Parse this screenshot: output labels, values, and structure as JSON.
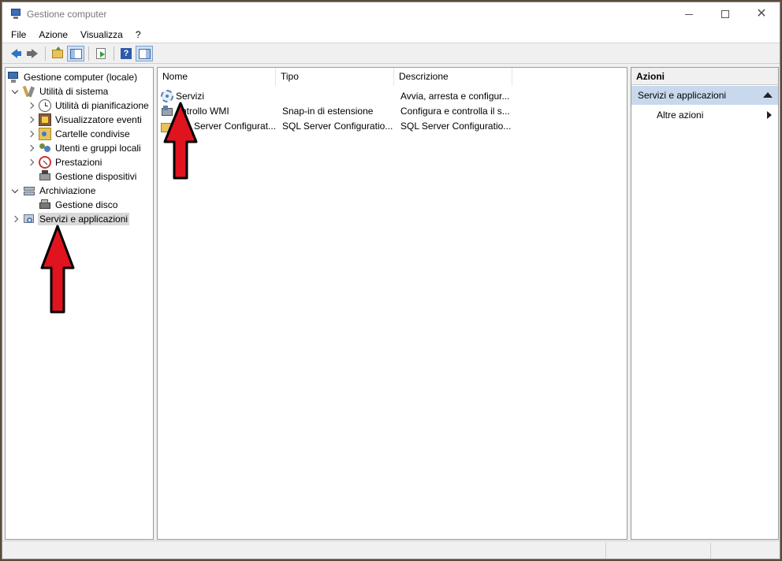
{
  "window": {
    "title": "Gestione computer"
  },
  "menu": [
    {
      "label": "File"
    },
    {
      "label": "Azione"
    },
    {
      "label": "Visualizza"
    },
    {
      "label": "?"
    }
  ],
  "toolbar": {
    "icons": [
      "back-arrow-icon",
      "forward-arrow-icon",
      "up-folder-icon",
      "show-hide-tree-icon",
      "export-list-icon",
      "help-icon",
      "show-hide-actions-icon"
    ]
  },
  "tree": {
    "root": "Gestione computer (locale)",
    "system_tools": "Utilità di sistema",
    "scheduler": "Utilità di pianificazione",
    "event_viewer": "Visualizzatore eventi",
    "shared_folders": "Cartelle condivise",
    "local_users": "Utenti e gruppi locali",
    "performance": "Prestazioni",
    "device_manager": "Gestione dispositivi",
    "storage": "Archiviazione",
    "disk_management": "Gestione disco",
    "services_apps": "Servizi e applicazioni"
  },
  "list": {
    "columns": [
      "Nome",
      "Tipo",
      "Descrizione"
    ],
    "rows": [
      {
        "name": "Servizi",
        "type": "",
        "description": "Avvia, arresta e configur..."
      },
      {
        "name": "ntrollo WMI",
        "type": "Snap-in di estensione",
        "description": "Configura e controlla il s..."
      },
      {
        "name": "Server Configurat...",
        "type": "SQL Server Configuratio...",
        "description": "SQL Server Configuratio..."
      }
    ]
  },
  "actions": {
    "header": "Azioni",
    "section": "Servizi e applicazioni",
    "more": "Altre azioni"
  },
  "colors": {
    "selection": "#d9d9d9",
    "actions_section": "#c8d9ee",
    "annotation_arrow": "#e0141e"
  }
}
